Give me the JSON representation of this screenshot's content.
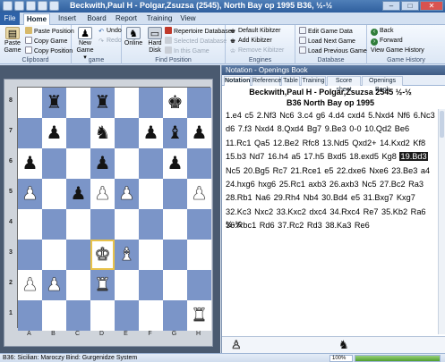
{
  "window": {
    "title": "Beckwith,Paul H - Polgar,Zsuzsa (2545), North Bay op 1995  B36, ½-½"
  },
  "ribbon": {
    "file_label": "File",
    "tabs": [
      "Home",
      "Insert",
      "Board",
      "Report",
      "Training",
      "View"
    ],
    "active_tab": "Home",
    "clipboard": {
      "label": "Clipboard",
      "paste_game": "Paste Game",
      "paste_position": "Paste Position",
      "copy_game": "Copy Game",
      "copy_position": "Copy Position"
    },
    "game": {
      "label": "game",
      "new_game": "New Game",
      "undo": "Undo",
      "redo": "Redo"
    },
    "find_position": {
      "label": "Find Position",
      "online": "Online",
      "hard_disk": "Hard Disk",
      "repertoire_db": "Repertoire Database",
      "selected_db": "Selected Database",
      "in_this_game": "In this Game"
    },
    "engines": {
      "label": "Engines",
      "default_kibitzer": "Default Kibitzer",
      "add_kibitzer": "Add Kibitzer",
      "remove_kibitzer": "Remove Kibitzer"
    },
    "database": {
      "label": "Database",
      "edit_game_data": "Edit Game Data",
      "load_next_game": "Load Next Game",
      "load_previous_game": "Load Previous Game"
    },
    "game_history": {
      "label": "Game History",
      "back": "Back",
      "forward": "Forward",
      "view_history": "View Game History"
    }
  },
  "board": {
    "rank_labels": [
      "8",
      "7",
      "6",
      "5",
      "4",
      "3",
      "2",
      "1"
    ],
    "file_labels": [
      "A",
      "B",
      "C",
      "D",
      "E",
      "F",
      "G",
      "H"
    ],
    "rows": [
      [
        ".",
        "r",
        ".",
        "r",
        ".",
        ".",
        "k",
        "."
      ],
      [
        ".",
        "p",
        ".",
        "n",
        ".",
        "p",
        "b",
        "p"
      ],
      [
        "p",
        ".",
        ".",
        "p",
        ".",
        ".",
        "p",
        "."
      ],
      [
        "P",
        ".",
        "p",
        "P",
        "P",
        ".",
        ".",
        "P"
      ],
      [
        ".",
        ".",
        ".",
        ".",
        ".",
        ".",
        ".",
        "."
      ],
      [
        ".",
        ".",
        ".",
        "K",
        "B",
        ".",
        ".",
        "."
      ],
      [
        "P",
        "P",
        ".",
        "R",
        ".",
        ".",
        ".",
        "."
      ],
      [
        ".",
        ".",
        ".",
        ".",
        ".",
        ".",
        ".",
        "R"
      ]
    ],
    "highlight_squares": [
      "d3"
    ]
  },
  "notation": {
    "panel_title": "Notation - Openings Book",
    "tabs": [
      "Notation",
      "Reference",
      "Table",
      "Training",
      "Score sheet",
      "Openings Book"
    ],
    "active_tab": "Notation",
    "header_line1": "Beckwith,Paul H - Polgar,Zsuzsa 2545  ½-½",
    "header_line2": "B36 North Bay op 1995",
    "moves_before": "1.e4 c5 2.Nf3 Nc6 3.c4 g6 4.d4 cxd4 5.Nxd4 Nf6 6.Nc3 d6 7.f3 Nxd4 8.Qxd4 Bg7 9.Be3 0-0 10.Qd2 Be6 11.Rc1 Qa5 12.Be2 Rfc8 13.Nd5 Qxd2+ 14.Kxd2 Kf8 15.b3 Nd7 16.h4 a5 17.h5 Bxd5 18.exd5 Kg8",
    "current_move": "19.Bd3",
    "moves_after": "Nc5 20.Bg5 Rc7 21.Rce1 e5 22.dxe6 Nxe6 23.Be3 a4 24.hxg6 hxg6 25.Rc1 axb3 26.axb3 Nc5 27.Bc2 Ra3 28.Rb1 Na6 29.Rh4 Nb4 30.Bd4 e5 31.Bxg7 Kxg7 32.Kc3 Nxc2 33.Kxc2 dxc4 34.Rxc4 Re7 35.Kb2 Ra6 36.Rbc1 Rd6 37.Rc2 Rd3 38.Ka3 Re6",
    "result": "½-½",
    "footer_white_icon": "white-pawn-icon",
    "footer_black_icon": "black-knight-icon"
  },
  "status": {
    "text": "B36: Sicilian: Maroczy Bind: Gurgenidze System",
    "zoom_label": "100%",
    "progress": 1.0
  },
  "colors": {
    "dark_square": "#7b95c8",
    "light_square": "#ffffff",
    "panel_bg": "#4a5a70",
    "accent": "#2e62a8"
  }
}
